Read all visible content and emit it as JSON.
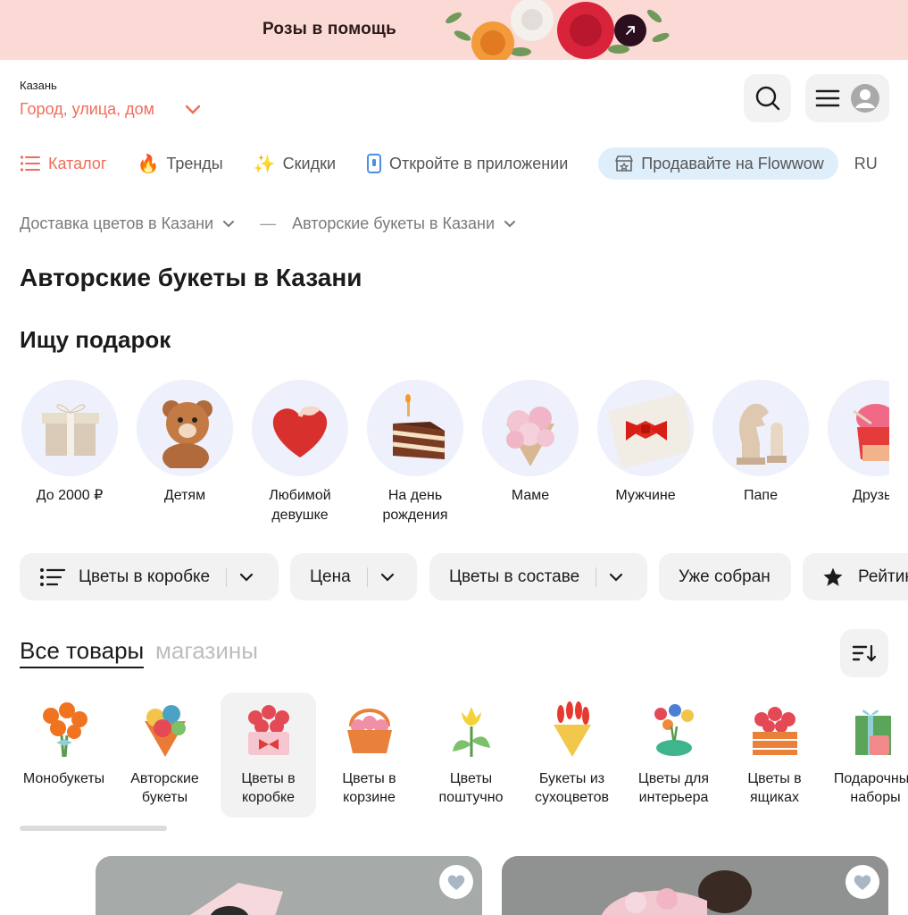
{
  "banner": {
    "title": "Розы в помощь"
  },
  "header": {
    "city": "Казань",
    "address_placeholder": "Город, улица, дом"
  },
  "nav": {
    "items": [
      {
        "label": "Каталог",
        "icon": "list-icon"
      },
      {
        "label": "Тренды",
        "icon": "fire-icon"
      },
      {
        "label": "Скидки",
        "icon": "sparkles-icon"
      },
      {
        "label": "Откройте в приложении",
        "icon": "phone-icon"
      },
      {
        "label": "Продавайте на Flowwow",
        "icon": "shop-icon"
      },
      {
        "label": "RU"
      }
    ]
  },
  "breadcrumbs": [
    "Доставка цветов в Казани",
    "—",
    "Авторские букеты в Казани"
  ],
  "page_title": "Авторские букеты в Казани",
  "gift_section": {
    "title": "Ищу подарок",
    "items": [
      {
        "label": "До 2000 ₽",
        "icon": "gift-box-icon"
      },
      {
        "label": "Детям",
        "icon": "teddy-bear-icon"
      },
      {
        "label": "Любимой девушке",
        "icon": "heart-box-icon"
      },
      {
        "label": "На день рождения",
        "icon": "cake-icon"
      },
      {
        "label": "Маме",
        "icon": "peony-bouquet-icon"
      },
      {
        "label": "Мужчине",
        "icon": "bow-tie-icon"
      },
      {
        "label": "Папе",
        "icon": "chess-icon"
      },
      {
        "label": "Друзья",
        "icon": "ice-cream-icon"
      }
    ]
  },
  "filters": {
    "items": [
      {
        "label": "Цветы в коробке",
        "has_dropdown": true,
        "icon": "list-icon"
      },
      {
        "label": "Цена",
        "has_dropdown": true
      },
      {
        "label": "Цветы в составе",
        "has_dropdown": true
      },
      {
        "label": "Уже собран",
        "has_dropdown": false
      },
      {
        "label": "Рейтинг",
        "has_dropdown": false,
        "icon": "star-icon"
      }
    ]
  },
  "tabs": {
    "active": "Все товары",
    "inactive": "магазины"
  },
  "categories": {
    "items": [
      {
        "label": "Монобукеты"
      },
      {
        "label": "Авторские букеты"
      },
      {
        "label": "Цветы в коробке",
        "active": true
      },
      {
        "label": "Цветы в корзине"
      },
      {
        "label": "Цветы поштучно"
      },
      {
        "label": "Букеты из сухоцветов"
      },
      {
        "label": "Цветы для интерьера"
      },
      {
        "label": "Цветы в ящиках"
      },
      {
        "label": "Подарочные наборы"
      }
    ]
  },
  "colors": {
    "accent": "#f26c5a",
    "banner_bg": "#fbd9d5",
    "chip_bg": "#f2f2f2",
    "sell_bg": "#dfeefb"
  }
}
